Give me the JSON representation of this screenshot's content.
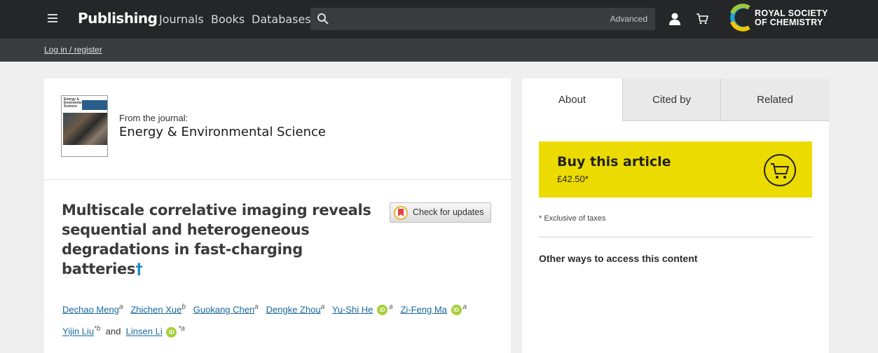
{
  "header": {
    "brand": "Publishing",
    "nav": [
      "Journals",
      "Books",
      "Databases"
    ],
    "search_placeholder": "",
    "search_advanced": "Advanced",
    "org_line1": "ROYAL SOCIETY",
    "org_line2": "OF CHEMISTRY",
    "login": "Log in / register"
  },
  "journal": {
    "from_label": "From the journal:",
    "name": "Energy & Environmental Science",
    "cover_title": "Energy & Environmental Science"
  },
  "article": {
    "title": "Multiscale correlative imaging reveals sequential and heterogeneous degradations in fast-charging batteries",
    "dagger": "†",
    "check_updates": "Check for updates",
    "authors": [
      {
        "name": "Dechao Meng",
        "aff": "a",
        "orcid": false
      },
      {
        "name": "Zhichen Xue",
        "aff": "b",
        "orcid": false
      },
      {
        "name": "Guokang Chen",
        "aff": "a",
        "orcid": false
      },
      {
        "name": "Dengke Zhou",
        "aff": "a",
        "orcid": false
      },
      {
        "name": "Yu-Shi He",
        "aff": "a",
        "orcid": true
      },
      {
        "name": "Zi-Feng Ma",
        "aff": "a",
        "orcid": true
      },
      {
        "name": "Yijin Liu",
        "aff": "*b",
        "orcid": false
      },
      {
        "name": "Linsen Li",
        "aff": "*a",
        "orcid": true
      }
    ],
    "and_word": "and"
  },
  "sidebar": {
    "tabs": [
      "About",
      "Cited by",
      "Related"
    ],
    "buy_title": "Buy this article",
    "buy_price": "£42.50*",
    "tax_note": "* Exclusive of taxes",
    "other_ways": "Other ways to access this content"
  },
  "colors": {
    "topbar": "#252627",
    "buy_accent": "#ecdb00",
    "link": "#1a6a9c",
    "orcid": "#a6ce39"
  }
}
